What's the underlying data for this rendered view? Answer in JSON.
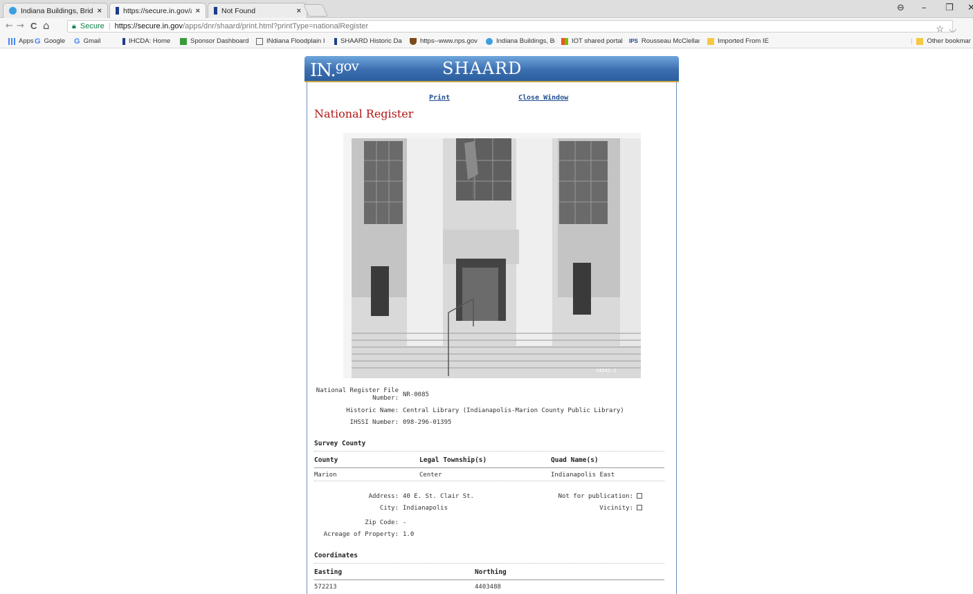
{
  "browser": {
    "tabs": [
      {
        "label": "Indiana Buildings, Bridge"
      },
      {
        "label": "https://secure.in.gov/app"
      },
      {
        "label": "Not Found"
      }
    ],
    "close_glyph": "×",
    "window_controls": {
      "profile": "⊖",
      "minimize": "–",
      "restore": "❐",
      "close": "✕"
    },
    "nav": {
      "back": "←",
      "forward": "→",
      "reload": "C",
      "home": "⌂"
    },
    "omnibox": {
      "secure_label": "Secure",
      "url_scheme_host": "https://secure.in.gov",
      "url_path": "/apps/dnr/shaard/print.html?printType=nationalRegister"
    },
    "bookmarks": [
      {
        "label": "Apps"
      },
      {
        "label": "Google"
      },
      {
        "label": "Gmail"
      },
      {
        "label": "IHCDA: Home"
      },
      {
        "label": "Sponsor Dashboard"
      },
      {
        "label": "INdiana Floodplain I"
      },
      {
        "label": "SHAARD Historic Da"
      },
      {
        "label": "https--www.nps.gov"
      },
      {
        "label": "Indiana Buildings, Br"
      },
      {
        "label": "IOT shared portal"
      },
      {
        "label": "Rousseau McClellan"
      },
      {
        "label": "Imported From IE"
      },
      {
        "label": "Other bookmar"
      }
    ],
    "colors": {
      "secure": "#0b8043",
      "accent_blue": "#3c6fb0",
      "title_red": "#b01515"
    }
  },
  "header": {
    "logo": {
      "main": "IN.",
      "sup": "gov"
    },
    "app_title": "SHAARD"
  },
  "page": {
    "print_link": "Print",
    "close_link": "Close Window",
    "title": "National Register",
    "photo_caption_mark": "34243-2",
    "details": [
      {
        "label": "National Register File Number:",
        "value": "NR-0085"
      },
      {
        "label": "Historic Name:",
        "value": "Central Library (Indianapolis-Marion County Public Library)"
      },
      {
        "label": "IHSSI Number:",
        "value": "098-296-01395"
      }
    ],
    "survey_county": {
      "heading": "Survey County",
      "columns": [
        "County",
        "Legal Township(s)",
        "Quad Name(s)"
      ],
      "rows": [
        [
          "Marion",
          "Center",
          "Indianapolis East"
        ]
      ]
    },
    "location": {
      "address_label": "Address:",
      "address": "40 E. St. Clair St.",
      "city_label": "City:",
      "city": "Indianapolis",
      "zip_label": "Zip Code:",
      "zip": "-",
      "acreage_label": "Acreage of Property:",
      "acreage": "1.0",
      "not_for_pub_label": "Not for publication:",
      "vicinity_label": "Vicinity:"
    },
    "coordinates": {
      "heading": "Coordinates",
      "columns": [
        "Easting",
        "Northing"
      ],
      "rows": [
        [
          "572213",
          "4403488"
        ]
      ]
    }
  }
}
